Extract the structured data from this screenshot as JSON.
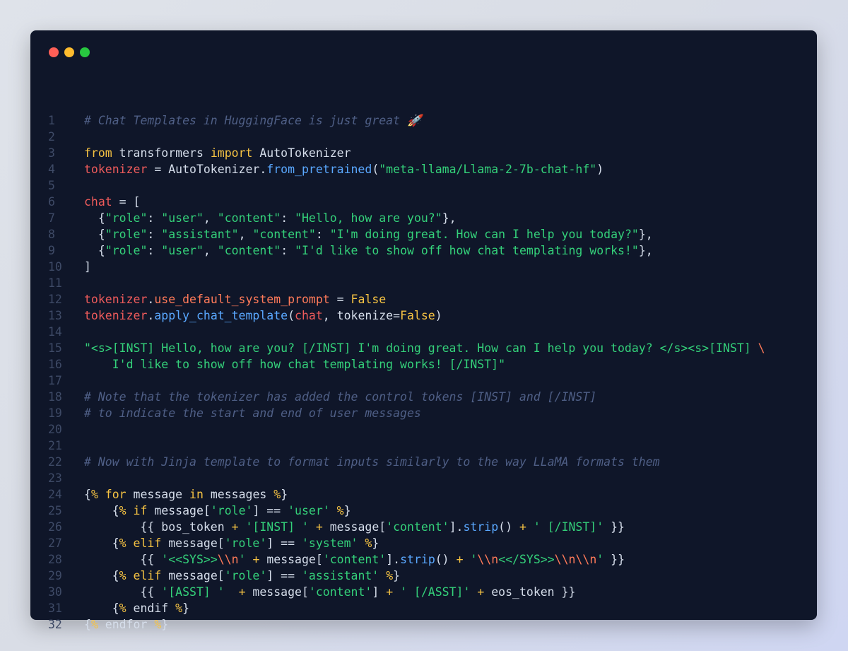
{
  "window": {
    "traffic_lights": [
      {
        "name": "close",
        "color": "#ff5f57"
      },
      {
        "name": "minimize",
        "color": "#febc2e"
      },
      {
        "name": "maximize",
        "color": "#28c840"
      }
    ]
  },
  "colors": {
    "comment": "#4f5f86",
    "keyword": "#f6c343",
    "variable": "#ef5b5b",
    "function": "#5aa8ff",
    "string": "#34d17a",
    "escape": "#ff7a59",
    "text": "#d6deeb",
    "line_number": "#3e4a66",
    "background": "#0f1629"
  },
  "lines": [
    [
      {
        "t": "# Chat Templates in HuggingFace is just great 🚀",
        "c": "c"
      }
    ],
    [],
    [
      {
        "t": "from",
        "c": "k"
      },
      {
        "t": " transformers ",
        "c": "o"
      },
      {
        "t": "import",
        "c": "k"
      },
      {
        "t": " AutoTokenizer",
        "c": "o"
      }
    ],
    [
      {
        "t": "tokenizer",
        "c": "v"
      },
      {
        "t": " = AutoTokenizer.",
        "c": "o"
      },
      {
        "t": "from_pretrained",
        "c": "f"
      },
      {
        "t": "(",
        "c": "o"
      },
      {
        "t": "\"meta-llama/Llama-2-7b-chat-hf\"",
        "c": "s"
      },
      {
        "t": ")",
        "c": "o"
      }
    ],
    [],
    [
      {
        "t": "chat",
        "c": "v"
      },
      {
        "t": " = [",
        "c": "o"
      }
    ],
    [
      {
        "t": "  {",
        "c": "o"
      },
      {
        "t": "\"role\"",
        "c": "s"
      },
      {
        "t": ": ",
        "c": "o"
      },
      {
        "t": "\"user\"",
        "c": "s"
      },
      {
        "t": ", ",
        "c": "o"
      },
      {
        "t": "\"content\"",
        "c": "s"
      },
      {
        "t": ": ",
        "c": "o"
      },
      {
        "t": "\"Hello, how are you?\"",
        "c": "s"
      },
      {
        "t": "},",
        "c": "o"
      }
    ],
    [
      {
        "t": "  {",
        "c": "o"
      },
      {
        "t": "\"role\"",
        "c": "s"
      },
      {
        "t": ": ",
        "c": "o"
      },
      {
        "t": "\"assistant\"",
        "c": "s"
      },
      {
        "t": ", ",
        "c": "o"
      },
      {
        "t": "\"content\"",
        "c": "s"
      },
      {
        "t": ": ",
        "c": "o"
      },
      {
        "t": "\"I'm doing great. How can I help you today?\"",
        "c": "s"
      },
      {
        "t": "},",
        "c": "o"
      }
    ],
    [
      {
        "t": "  {",
        "c": "o"
      },
      {
        "t": "\"role\"",
        "c": "s"
      },
      {
        "t": ": ",
        "c": "o"
      },
      {
        "t": "\"user\"",
        "c": "s"
      },
      {
        "t": ", ",
        "c": "o"
      },
      {
        "t": "\"content\"",
        "c": "s"
      },
      {
        "t": ": ",
        "c": "o"
      },
      {
        "t": "\"I'd like to show off how chat templating works!\"",
        "c": "s"
      },
      {
        "t": "},",
        "c": "o"
      }
    ],
    [
      {
        "t": "]",
        "c": "o"
      }
    ],
    [],
    [
      {
        "t": "tokenizer",
        "c": "v"
      },
      {
        "t": ".",
        "c": "o"
      },
      {
        "t": "use_default_system_prompt",
        "c": "e"
      },
      {
        "t": " = ",
        "c": "o"
      },
      {
        "t": "False",
        "c": "k"
      }
    ],
    [
      {
        "t": "tokenizer",
        "c": "v"
      },
      {
        "t": ".",
        "c": "o"
      },
      {
        "t": "apply_chat_template",
        "c": "f"
      },
      {
        "t": "(",
        "c": "o"
      },
      {
        "t": "chat",
        "c": "v"
      },
      {
        "t": ", tokenize=",
        "c": "o"
      },
      {
        "t": "False",
        "c": "k"
      },
      {
        "t": ")",
        "c": "o"
      }
    ],
    [],
    [
      {
        "t": "\"<s>[INST] Hello, how are you? [/INST] I'm doing great. How can I help you today? </s><s>[INST] ",
        "c": "s"
      },
      {
        "t": "\\",
        "c": "e"
      }
    ],
    [
      {
        "t": "    I'd like to show off how chat templating works! [/INST]\"",
        "c": "s"
      }
    ],
    [],
    [
      {
        "t": "# Note that the tokenizer has added the control tokens [INST] and [/INST]",
        "c": "c"
      }
    ],
    [
      {
        "t": "# to indicate the start and end of user messages",
        "c": "c"
      }
    ],
    [],
    [],
    [
      {
        "t": "# Now with Jinja template to format inputs similarly to the way LLaMA formats them",
        "c": "c"
      }
    ],
    [],
    [
      {
        "t": "{",
        "c": "o"
      },
      {
        "t": "%",
        "c": "k"
      },
      {
        "t": " for",
        "c": "k"
      },
      {
        "t": " message ",
        "c": "o"
      },
      {
        "t": "in",
        "c": "k"
      },
      {
        "t": " messages ",
        "c": "o"
      },
      {
        "t": "%",
        "c": "k"
      },
      {
        "t": "}",
        "c": "o"
      }
    ],
    [
      {
        "t": "    {",
        "c": "o"
      },
      {
        "t": "%",
        "c": "k"
      },
      {
        "t": " if",
        "c": "k"
      },
      {
        "t": " message[",
        "c": "o"
      },
      {
        "t": "'role'",
        "c": "s"
      },
      {
        "t": "] == ",
        "c": "o"
      },
      {
        "t": "'user'",
        "c": "s"
      },
      {
        "t": " ",
        "c": "o"
      },
      {
        "t": "%",
        "c": "k"
      },
      {
        "t": "}",
        "c": "o"
      }
    ],
    [
      {
        "t": "        {{ bos_token ",
        "c": "o"
      },
      {
        "t": "+",
        "c": "k"
      },
      {
        "t": " ",
        "c": "o"
      },
      {
        "t": "'[INST] '",
        "c": "s"
      },
      {
        "t": " ",
        "c": "o"
      },
      {
        "t": "+",
        "c": "k"
      },
      {
        "t": " message[",
        "c": "o"
      },
      {
        "t": "'content'",
        "c": "s"
      },
      {
        "t": "].",
        "c": "o"
      },
      {
        "t": "strip",
        "c": "f"
      },
      {
        "t": "() ",
        "c": "o"
      },
      {
        "t": "+",
        "c": "k"
      },
      {
        "t": " ",
        "c": "o"
      },
      {
        "t": "' [/INST]'",
        "c": "s"
      },
      {
        "t": " }}",
        "c": "o"
      }
    ],
    [
      {
        "t": "    {",
        "c": "o"
      },
      {
        "t": "%",
        "c": "k"
      },
      {
        "t": " elif",
        "c": "k"
      },
      {
        "t": " message[",
        "c": "o"
      },
      {
        "t": "'role'",
        "c": "s"
      },
      {
        "t": "] == ",
        "c": "o"
      },
      {
        "t": "'system'",
        "c": "s"
      },
      {
        "t": " ",
        "c": "o"
      },
      {
        "t": "%",
        "c": "k"
      },
      {
        "t": "}",
        "c": "o"
      }
    ],
    [
      {
        "t": "        {{ ",
        "c": "o"
      },
      {
        "t": "'<<SYS>>",
        "c": "s"
      },
      {
        "t": "\\\\n",
        "c": "e"
      },
      {
        "t": "'",
        "c": "s"
      },
      {
        "t": " ",
        "c": "o"
      },
      {
        "t": "+",
        "c": "k"
      },
      {
        "t": " message[",
        "c": "o"
      },
      {
        "t": "'content'",
        "c": "s"
      },
      {
        "t": "].",
        "c": "o"
      },
      {
        "t": "strip",
        "c": "f"
      },
      {
        "t": "() ",
        "c": "o"
      },
      {
        "t": "+",
        "c": "k"
      },
      {
        "t": " ",
        "c": "o"
      },
      {
        "t": "'",
        "c": "s"
      },
      {
        "t": "\\\\n",
        "c": "e"
      },
      {
        "t": "<</SYS>>",
        "c": "s"
      },
      {
        "t": "\\\\n\\\\n",
        "c": "e"
      },
      {
        "t": "'",
        "c": "s"
      },
      {
        "t": " }}",
        "c": "o"
      }
    ],
    [
      {
        "t": "    {",
        "c": "o"
      },
      {
        "t": "%",
        "c": "k"
      },
      {
        "t": " elif",
        "c": "k"
      },
      {
        "t": " message[",
        "c": "o"
      },
      {
        "t": "'role'",
        "c": "s"
      },
      {
        "t": "] == ",
        "c": "o"
      },
      {
        "t": "'assistant'",
        "c": "s"
      },
      {
        "t": " ",
        "c": "o"
      },
      {
        "t": "%",
        "c": "k"
      },
      {
        "t": "}",
        "c": "o"
      }
    ],
    [
      {
        "t": "        {{ ",
        "c": "o"
      },
      {
        "t": "'[ASST] '",
        "c": "s"
      },
      {
        "t": "  ",
        "c": "o"
      },
      {
        "t": "+",
        "c": "k"
      },
      {
        "t": " message[",
        "c": "o"
      },
      {
        "t": "'content'",
        "c": "s"
      },
      {
        "t": "] ",
        "c": "o"
      },
      {
        "t": "+",
        "c": "k"
      },
      {
        "t": " ",
        "c": "o"
      },
      {
        "t": "' [/ASST]'",
        "c": "s"
      },
      {
        "t": " ",
        "c": "o"
      },
      {
        "t": "+",
        "c": "k"
      },
      {
        "t": " eos_token }}",
        "c": "o"
      }
    ],
    [
      {
        "t": "    {",
        "c": "o"
      },
      {
        "t": "%",
        "c": "k"
      },
      {
        "t": " endif ",
        "c": "o"
      },
      {
        "t": "%",
        "c": "k"
      },
      {
        "t": "}",
        "c": "o"
      }
    ],
    [
      {
        "t": "{",
        "c": "o"
      },
      {
        "t": "%",
        "c": "k"
      },
      {
        "t": " endfor ",
        "c": "o"
      },
      {
        "t": "%",
        "c": "k"
      },
      {
        "t": "}",
        "c": "o"
      }
    ]
  ]
}
